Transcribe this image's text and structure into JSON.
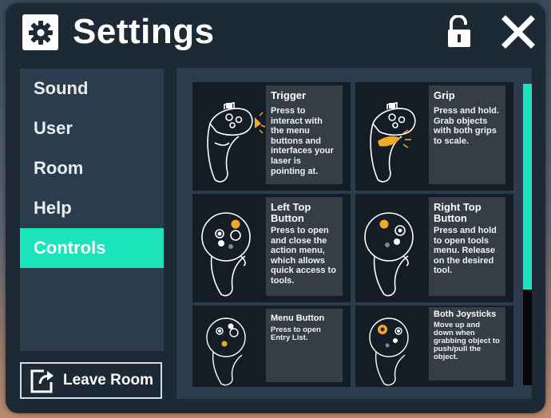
{
  "window": {
    "title": "Settings"
  },
  "icons": {
    "settings": "gear-icon",
    "lock": "unlock-icon",
    "close": "close-icon",
    "leave": "leave-room-icon"
  },
  "colors": {
    "accent": "#1de3bd",
    "highlight": "#f4a82a",
    "panel": "#2b3d4c",
    "window": "#1d2a35"
  },
  "sidebar": {
    "items": [
      {
        "label": "Sound",
        "active": false
      },
      {
        "label": "User",
        "active": false
      },
      {
        "label": "Room",
        "active": false
      },
      {
        "label": "Help",
        "active": false
      },
      {
        "label": "Controls",
        "active": true
      }
    ],
    "leave_label": "Leave Room"
  },
  "controls": [
    {
      "title": "Trigger",
      "desc": "Press to interact with the menu buttons and interfaces your laser is pointing at."
    },
    {
      "title": "Grip",
      "desc": "Press and hold. Grab objects with both grips to scale."
    },
    {
      "title": "Left Top Button",
      "desc": "Press to open and close the action menu, which allows quick access to tools."
    },
    {
      "title": "Right Top Button",
      "desc": "Press and hold to open tools menu. Release on the desired tool."
    },
    {
      "title": "Menu Button",
      "desc": "Press to open Entry List."
    },
    {
      "title": "Both Joysticks",
      "desc": "Move up and down when grabbing object to push/pull the object."
    }
  ],
  "scroll": {
    "position": 0.0,
    "visible_fraction": 0.68
  }
}
